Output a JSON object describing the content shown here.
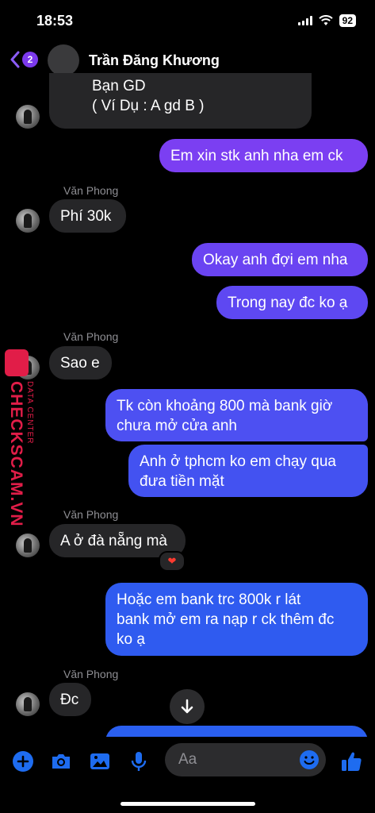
{
  "status_bar": {
    "time": "18:53",
    "battery": "92"
  },
  "header": {
    "back_count": "2",
    "contact_name": "Trần Đăng Khương"
  },
  "messages": [
    {
      "text": "Bạn GD\n( Ví Dụ : A gd B )"
    },
    {
      "text": "Em xin stk anh nha em ck"
    },
    {
      "sender": "Văn Phong",
      "text": "Phí 30k"
    },
    {
      "text": "Okay anh đợi em nha"
    },
    {
      "text": "Trong nay đc ko ạ"
    },
    {
      "sender": "Văn Phong",
      "text": "Sao e"
    },
    {
      "text": "Tk còn khoảng 800 mà bank giờ\nchưa mở cửa anh"
    },
    {
      "text": "Anh ở tphcm ko em chạy qua\nđưa tiền mặt"
    },
    {
      "sender": "Văn Phong",
      "text": "A ở đà nẵng mà",
      "reaction": "heart"
    },
    {
      "text": "Hoặc em bank trc 800k r lát\nbank mở em ra nạp r ck thêm đc\nko ạ"
    },
    {
      "sender": "Văn Phong",
      "text": "Đc"
    }
  ],
  "watermark": {
    "brand": "CHECKSCAM.VN",
    "sub": "DATA CENTER"
  },
  "composer": {
    "placeholder": "Aa"
  },
  "colors": {
    "outgoing_top": "#7b3ff2",
    "outgoing_bottom": "#2f5bf0",
    "incoming": "#262628",
    "accent": "#1e6cf0"
  }
}
